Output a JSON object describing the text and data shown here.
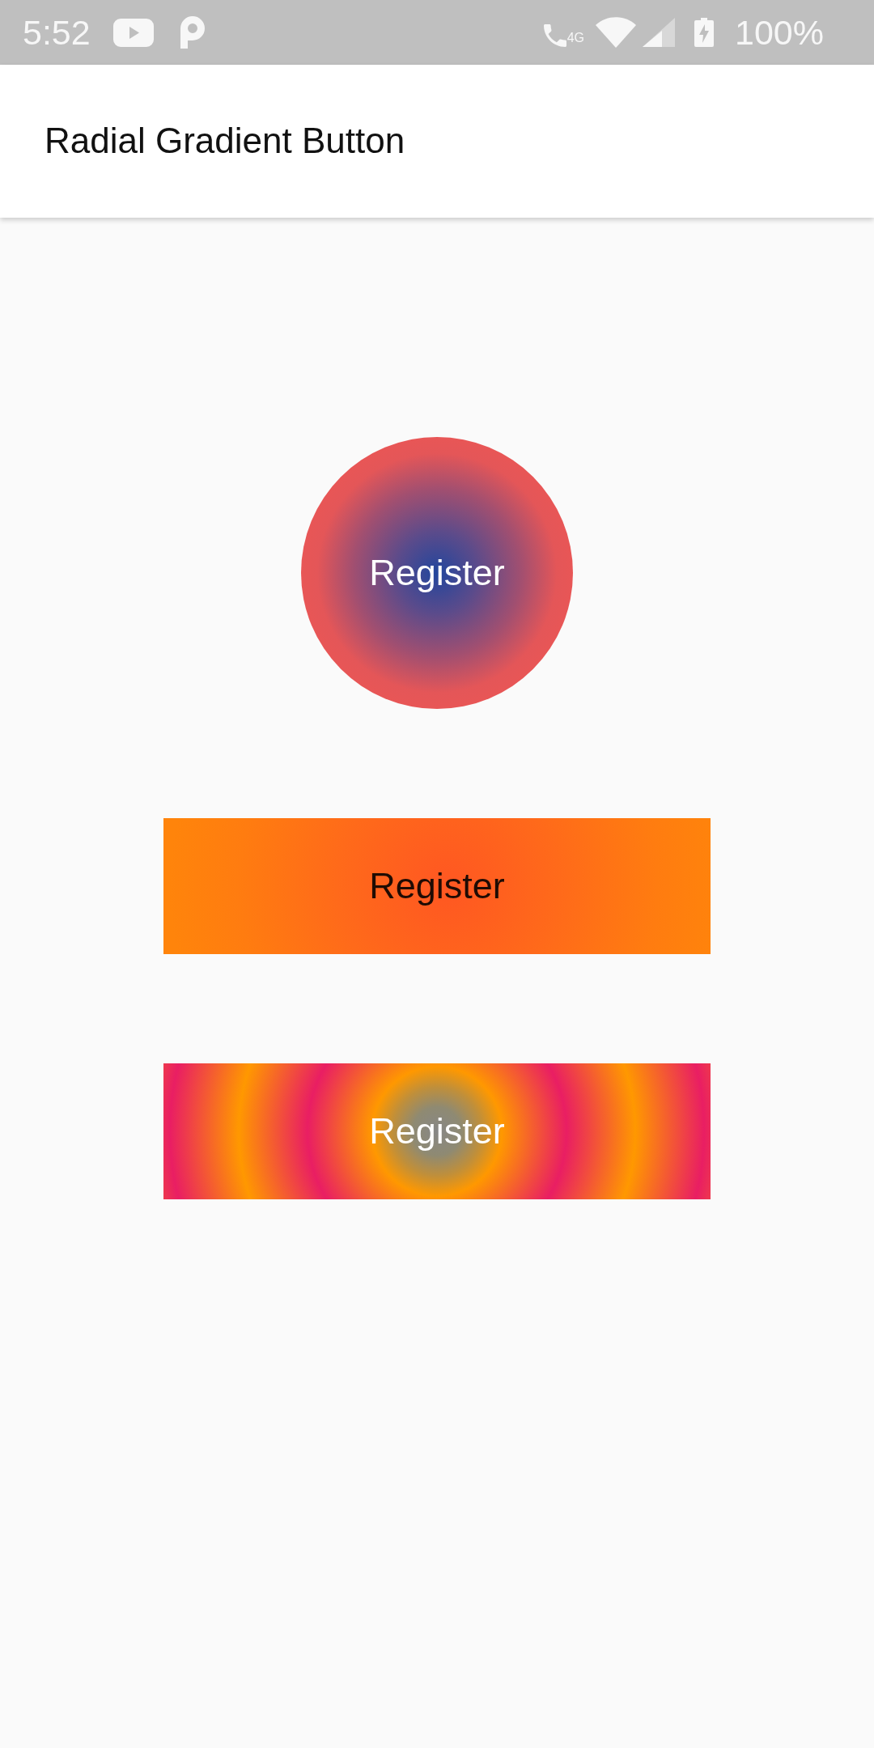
{
  "status_bar": {
    "time": "5:52",
    "network": "4G",
    "battery": "100%"
  },
  "app_bar": {
    "title": "Radial Gradient Button"
  },
  "buttons": [
    {
      "kind": "circle",
      "label": "Register"
    },
    {
      "kind": "soft",
      "label": "Register"
    },
    {
      "kind": "rings",
      "label": "Register"
    }
  ]
}
